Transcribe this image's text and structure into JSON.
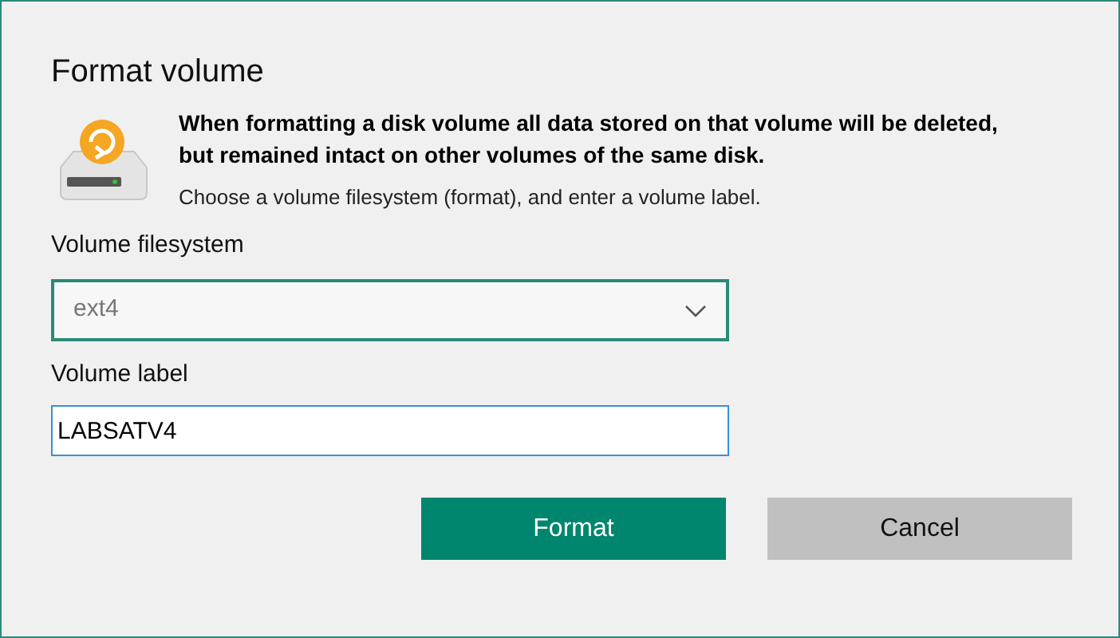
{
  "dialog": {
    "title": "Format volume",
    "warning": "When formatting a disk volume all data stored on that volume will be deleted, but remained intact on other volumes of the same disk.",
    "instruction": "Choose a volume filesystem (format), and enter a volume label.",
    "filesystem": {
      "label": "Volume filesystem",
      "value": "ext4"
    },
    "volume_label": {
      "label": "Volume label",
      "value": "LABSATV4"
    },
    "buttons": [
      {
        "label": "Format",
        "kind": "primary"
      },
      {
        "label": "Cancel",
        "kind": "secondary"
      }
    ]
  }
}
